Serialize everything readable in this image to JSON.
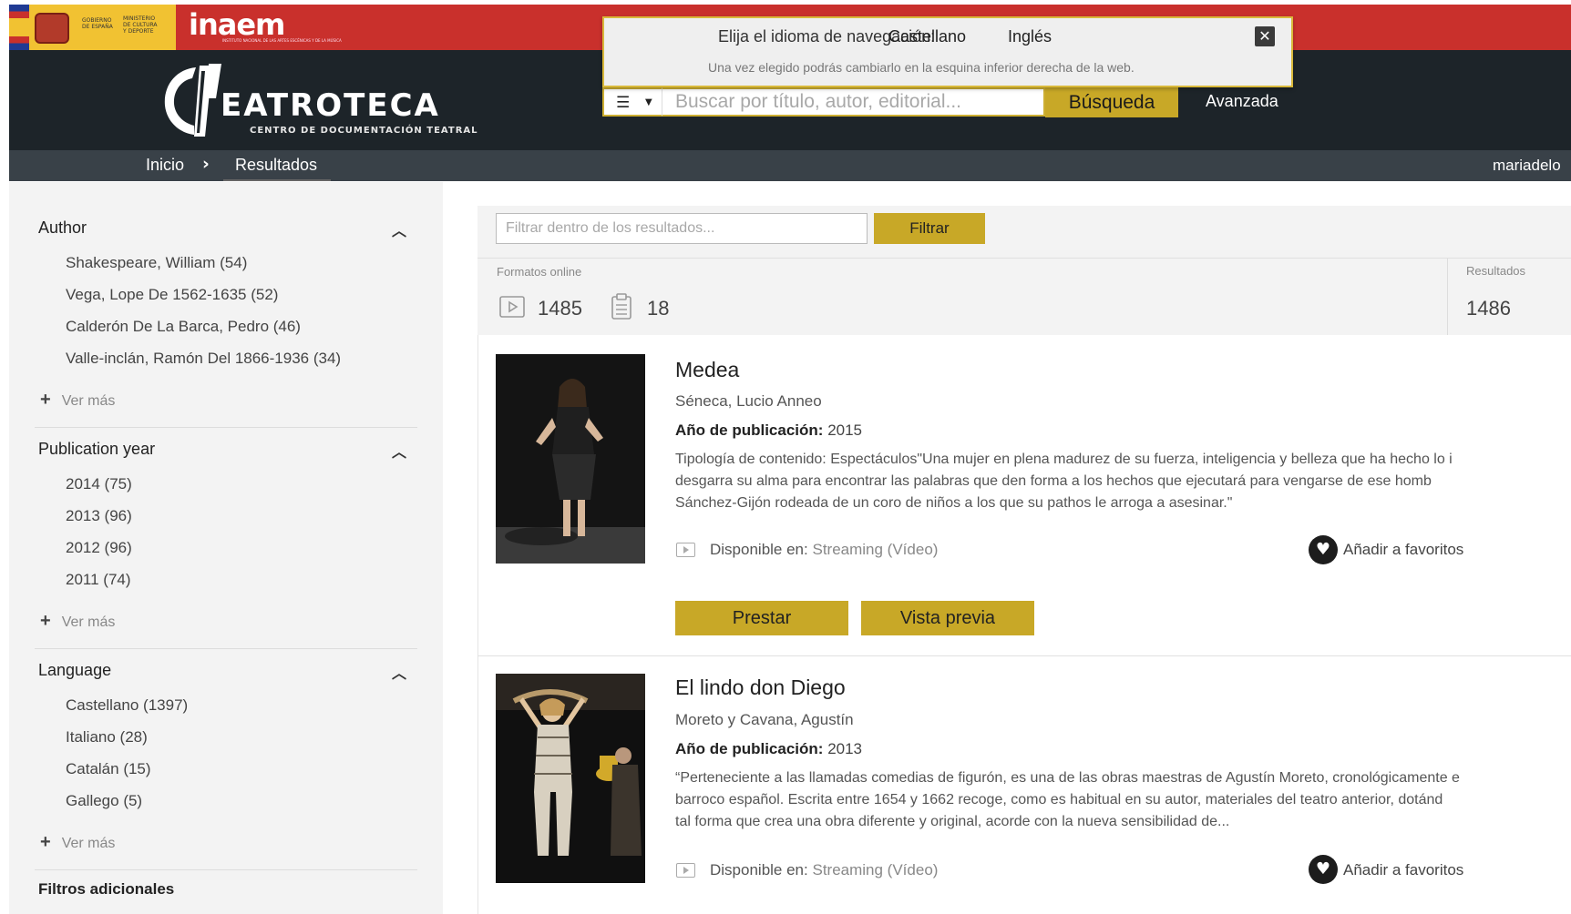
{
  "header": {
    "gov_text_1": "GOBIERNO\nDE ESPAÑA",
    "gov_text_2": "MINISTERIO\nDE CULTURA\nY DEPORTE",
    "inaem_logo": "inaem",
    "inaem_sub": "INSTITUTO NACIONAL DE LAS ARTES ESCÉNICAS Y DE LA MÚSICA",
    "logo_title": "EATROTECA",
    "logo_subtitle": "CENTRO DE DOCUMENTACIÓN TEATRAL"
  },
  "language_popup": {
    "prompt": "Elija el idioma de navegación:",
    "options": [
      "Castellano",
      "Inglés"
    ],
    "note": "Una vez elegido podrás cambiarlo en la esquina inferior derecha de la web.",
    "close_icon": "close-icon"
  },
  "search": {
    "placeholder": "Buscar por título, autor, editorial...",
    "button_label": "Búsqueda",
    "advanced_label": "Avanzada",
    "menu_icon": "list-icon"
  },
  "breadcrumb": {
    "home": "Inicio",
    "separator": "›",
    "current": "Resultados",
    "user": "mariadelo"
  },
  "facets": [
    {
      "title": "Author",
      "items": [
        "Shakespeare, William (54)",
        "Vega, Lope De 1562-1635 (52)",
        "Calderón De La Barca, Pedro (46)",
        "Valle-inclán, Ramón Del 1866-1936 (34)"
      ],
      "more": "Ver más"
    },
    {
      "title": "Publication year",
      "items": [
        "2014 (75)",
        "2013 (96)",
        "2012 (96)",
        "2011 (74)"
      ],
      "more": "Ver más"
    },
    {
      "title": "Language",
      "items": [
        "Castellano (1397)",
        "Italiano (28)",
        "Catalán (15)",
        "Gallego (5)"
      ],
      "more": "Ver más"
    }
  ],
  "additional_filters": "Filtros adicionales",
  "filter": {
    "placeholder": "Filtrar dentro de los resultados...",
    "button_label": "Filtrar"
  },
  "formats": {
    "label": "Formatos online",
    "video_count": "1485",
    "document_count": "18"
  },
  "results": {
    "label": "Resultados",
    "count": "1486"
  },
  "items": [
    {
      "title": "Medea",
      "author": "Séneca, Lucio Anneo",
      "year_label": "Año de publicación:",
      "year": "2015",
      "description_lines": [
        "Tipología de contenido: Espectáculos\"Una mujer en plena madurez de su fuerza, inteligencia y belleza que ha hecho lo i",
        "desgarra su alma para encontrar las palabras que den forma a los hechos que ejecutará para vengarse de ese homb",
        "Sánchez-Gijón rodeada de un coro de niños a los que su pathos le arroga a asesinar.\""
      ],
      "available_label": "Disponible en:",
      "available_value": "Streaming (Vídeo)",
      "favorite_label": "Añadir a favoritos",
      "borrow_label": "Prestar",
      "preview_label": "Vista previa"
    },
    {
      "title": "El lindo don Diego",
      "author": "Moreto y Cavana, Agustín",
      "year_label": "Año de publicación:",
      "year": "2013",
      "description_lines": [
        "“Perteneciente a las llamadas comedias de figurón, es una de las obras maestras de Agustín Moreto, cronológicamente e",
        "barroco español. Escrita entre 1654 y 1662 recoge, como es habitual en su autor, materiales del teatro anterior, dotánd",
        "tal forma que crea una obra diferente y original, acorde con la nueva sensibilidad de..."
      ],
      "available_label": "Disponible en:",
      "available_value": "Streaming (Vídeo)",
      "favorite_label": "Añadir a favoritos"
    }
  ],
  "colors": {
    "top_bar": "#c9302c",
    "masthead": "#1d2429",
    "breadcrumb_bar": "#394148",
    "accent_gold": "#c8a827",
    "sidebar_bg": "#f3f3f3"
  }
}
